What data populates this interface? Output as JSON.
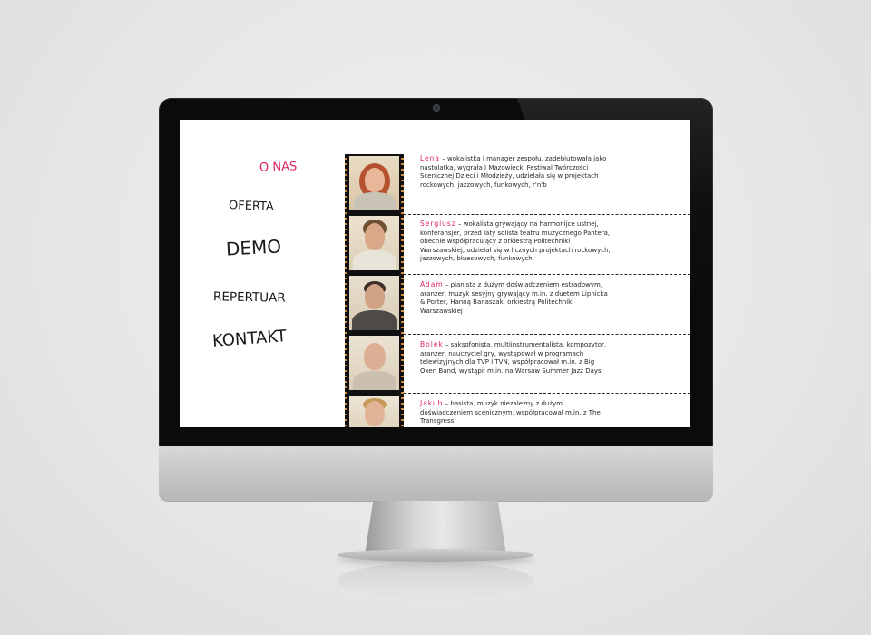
{
  "nav": {
    "o_nas": "O NAS",
    "oferta": "OFERTA",
    "demo": "DEMO",
    "repertuar": "REPERTUAR",
    "kontakt": "KONTAKT"
  },
  "accent_color": "#e0245e",
  "members": [
    {
      "name": "Lena",
      "desc": " – wokalistka i manager zespołu, zadebiu­towała jako nastolatka, wygrała I Mazowiecki Festiwal Twórczości Scenicznej Dzieci i Młodzieży, udzielała się w projektach rockowych, jazzowych, funkowych, r'n'b"
    },
    {
      "name": "Sergiusz",
      "desc": " – wokalista grywający na harmonijce ustnej, konferansjer, przed laty solista teatru muzycznego Pantera, obecnie współpracujący z orkiestrą Politechniki Warszawskiej, udzielał się w licznych projektach rockowych, jazzowych, bluesowych, funkowych"
    },
    {
      "name": "Adam",
      "desc": " – pianista z dużym doświadczeniem estra­dowym, aranżer, muzyk sesyjny grywający m.in. z duetem Lipnicka & Porter, Hanną Banaszak, orkiestrą Politechniki Warszawskiej"
    },
    {
      "name": "Bolek",
      "desc": " – saksofonista, multiinstrumentalista, kompozytor, aranżer, nauczyciel gry, występował w programach telewizyjnych dla TVP i TVN, współpracował m.in. z Big Oxen Band, wystąpił m.in. na Warsaw Summer Jazz Days"
    },
    {
      "name": "Jakub",
      "desc": " – basista, muzyk niezależny z dużym doświadczeniem scenicznym, współpracował m.in. z The Transgress"
    }
  ]
}
